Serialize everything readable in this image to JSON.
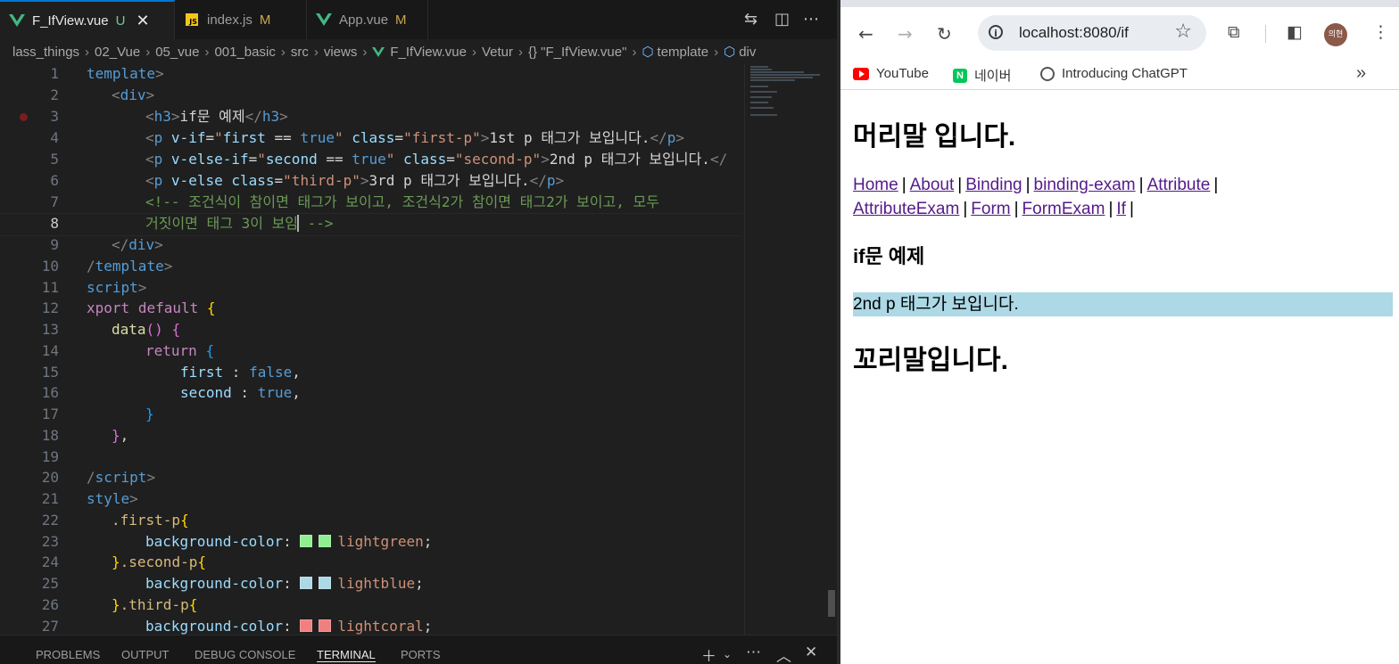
{
  "vscode": {
    "tabs": [
      {
        "label": "F_IfView.vue",
        "status": "U",
        "active": true,
        "icon": "vue-icon"
      },
      {
        "label": "index.js",
        "status": "M",
        "active": false,
        "icon": "js-icon"
      },
      {
        "label": "App.vue",
        "status": "M",
        "active": false,
        "icon": "vue-icon"
      }
    ],
    "breadcrumb": [
      "lass_things",
      "02_Vue",
      "05_vue",
      "001_basic",
      "src",
      "views",
      "F_IfView.vue",
      "Vetur",
      "{} \"F_IfView.vue\"",
      "template",
      "div"
    ],
    "line_numbers": [
      "1",
      "2",
      "3",
      "4",
      "5",
      "6",
      "7",
      "8",
      "9",
      "10",
      "11",
      "12",
      "13",
      "14",
      "15",
      "16",
      "17",
      "18",
      "19",
      "20",
      "21",
      "22",
      "23",
      "24",
      "25",
      "26",
      "27"
    ],
    "current_line": 8,
    "swatch_colors": {
      "lightgreen": "#90ee90",
      "lightblue": "#add8e6",
      "lightcoral": "#f08080"
    },
    "panel_tabs": [
      "PROBLEMS",
      "OUTPUT",
      "DEBUG CONSOLE",
      "TERMINAL",
      "PORTS"
    ],
    "active_panel_tab": "TERMINAL"
  },
  "browser": {
    "url": "localhost:8080/if",
    "profile_initials": "의현",
    "bookmarks": [
      "YouTube",
      "네이버",
      "Introducing ChatGPT"
    ],
    "page": {
      "header": "머리말 입니다.",
      "nav_links": [
        "Home",
        "About",
        "Binding",
        "binding-exam",
        "Attribute",
        "AttributeExam",
        "Form",
        "FormExam",
        "If"
      ],
      "title": "if문 예제",
      "paragraph": "2nd p 태그가 보입니다.",
      "paragraph_bg": "#add8e6",
      "footer": "꼬리말입니다."
    }
  }
}
